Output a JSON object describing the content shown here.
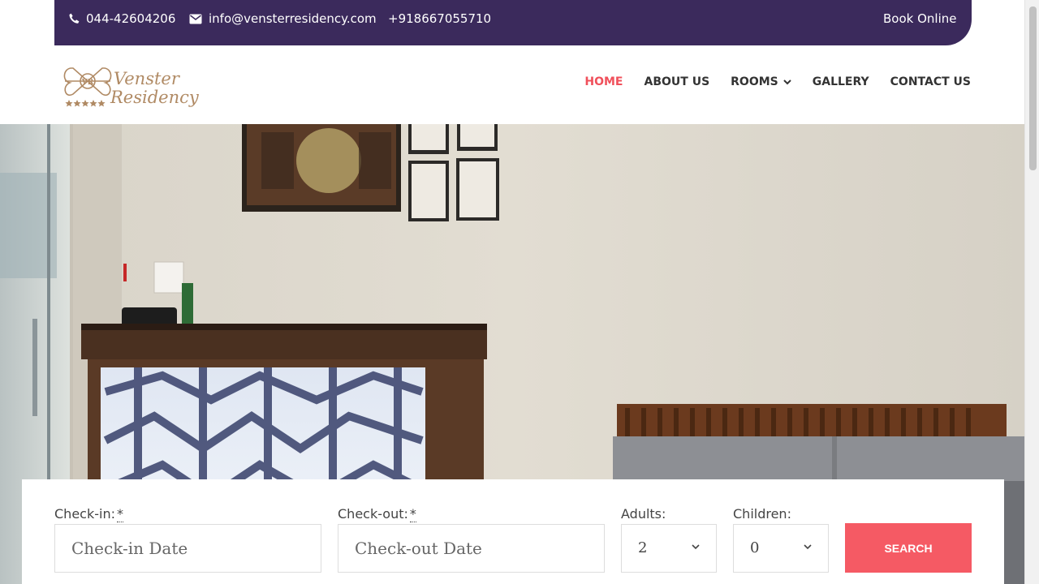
{
  "topbar": {
    "phone": "044-42604206",
    "email": "info@vensterresidency.com",
    "mobile": "+918667055710",
    "book_online": "Book Online"
  },
  "logo": {
    "monogram": "VR",
    "line1": "Venster",
    "line2": "Residency"
  },
  "nav": {
    "home": "HOME",
    "about": "ABOUT US",
    "rooms": "ROOMS",
    "gallery": "GALLERY",
    "contact": "CONTACT US"
  },
  "booking": {
    "checkin_label": "Check-in:",
    "checkin_placeholder": "Check-in Date",
    "checkout_label": "Check-out:",
    "checkout_placeholder": "Check-out Date",
    "required_mark": "*",
    "adults_label": "Adults:",
    "adults_value": "2",
    "children_label": "Children:",
    "children_value": "0",
    "search_label": "SEARCH"
  },
  "colors": {
    "topbar_bg": "#3b2a5c",
    "accent": "#f0505b",
    "button": "#f55a64"
  }
}
